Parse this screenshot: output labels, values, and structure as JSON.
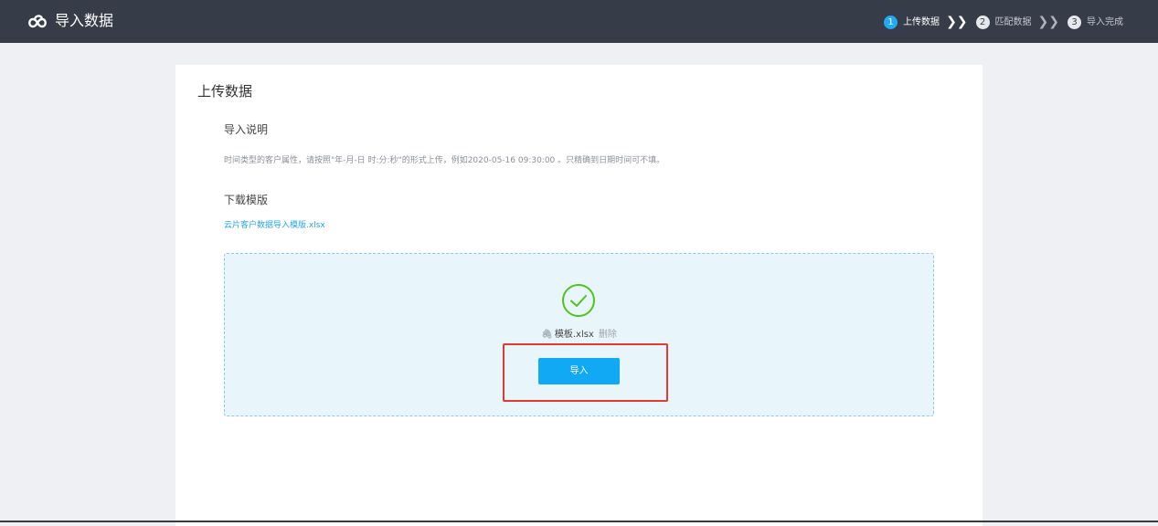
{
  "header": {
    "app_title": "导入数据",
    "logo_icon": "cloud-logo-icon",
    "steps": [
      {
        "num": "1",
        "label": "上传数据",
        "active": true
      },
      {
        "num": "2",
        "label": "匹配数据",
        "active": false
      },
      {
        "num": "3",
        "label": "导入完成",
        "active": false
      }
    ],
    "step_separator": "❯❯"
  },
  "card": {
    "title": "上传数据",
    "instructions_title": "导入说明",
    "instructions_text": "时间类型的客户属性，请按照\"年-月-日 时:分:秒\"的形式上传，例如2020-05-16 09:30:00 。只精确到日期时间可不填。",
    "template_title": "下载模版",
    "template_link": "云片客户数据导入模版.xlsx"
  },
  "upload": {
    "status_icon": "check-circle-icon",
    "file_icon": "paperclip-icon",
    "file_name": "模板.xlsx",
    "delete_label": "删除",
    "import_button": "导入"
  },
  "colors": {
    "topbar": "#363d49",
    "accent": "#11a8f4",
    "success": "#52c41a",
    "highlight": "#e23a30"
  }
}
